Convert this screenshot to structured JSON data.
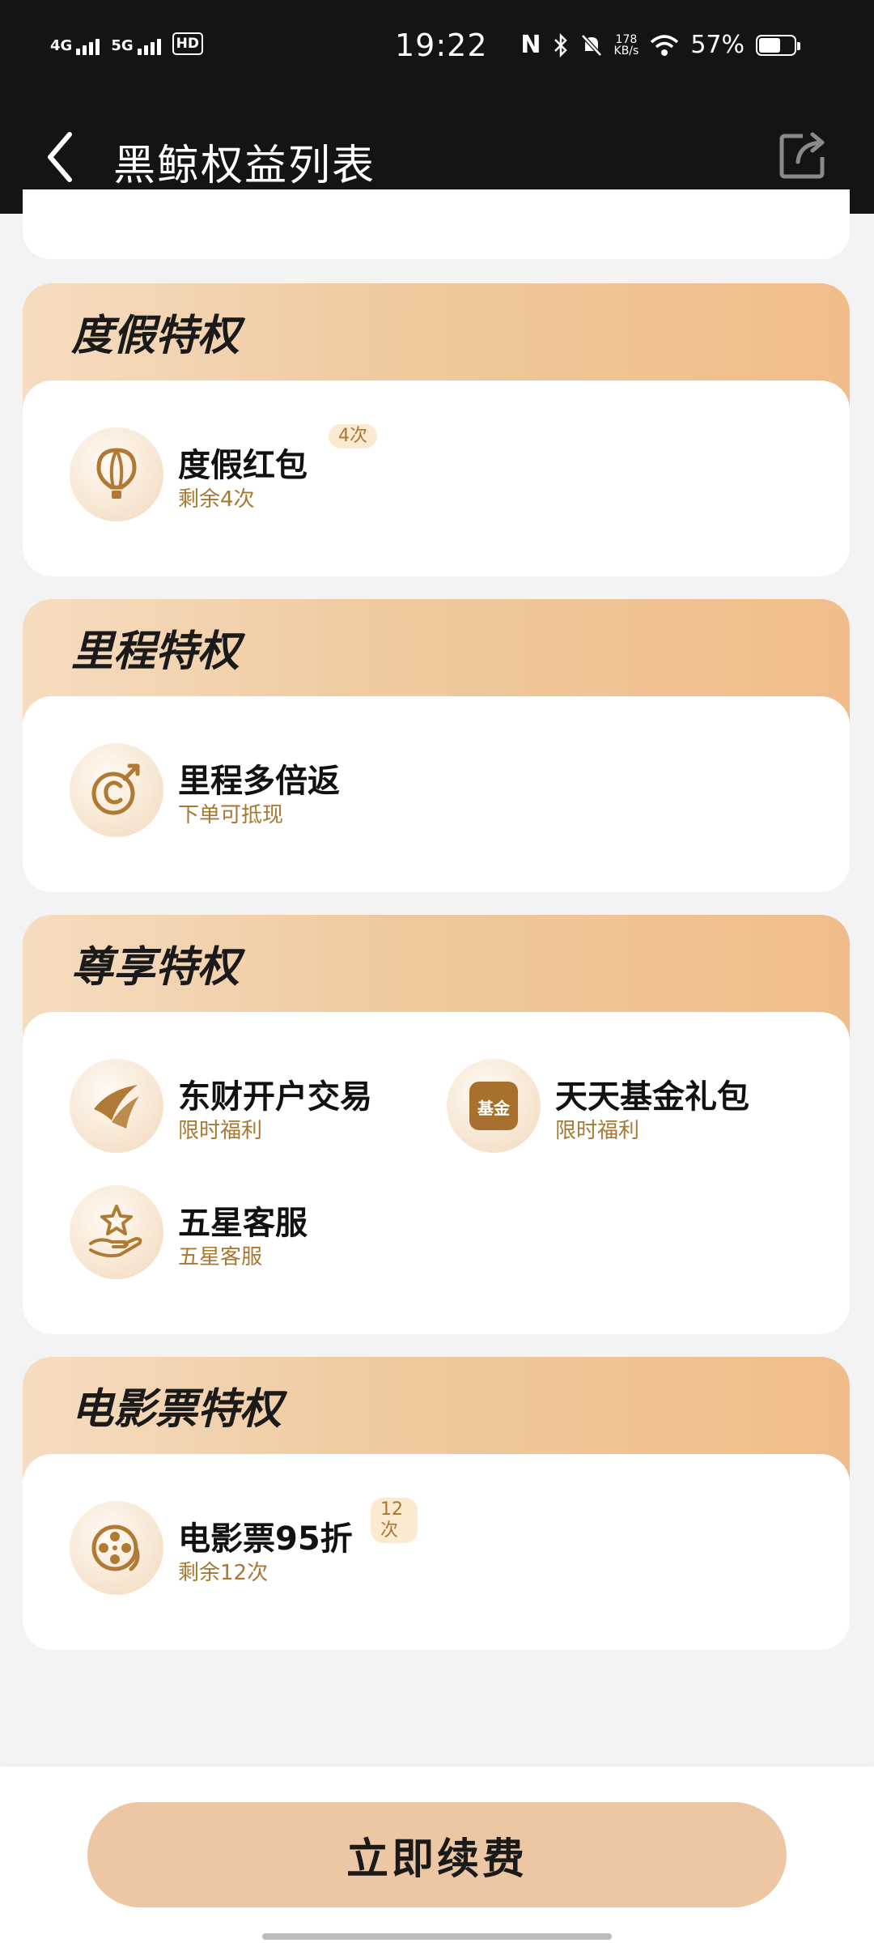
{
  "status_bar": {
    "signal1": "4G",
    "signal2": "5G",
    "hd": "HD",
    "time": "19:22",
    "speed_value": "178",
    "speed_unit": "KB/s",
    "battery": "57%"
  },
  "header": {
    "title": "黑鲸权益列表"
  },
  "sections": [
    {
      "title": "度假特权",
      "items": [
        {
          "name": "度假红包",
          "sub": "剩余4次",
          "badge": "4次",
          "icon": "hot-air-balloon-icon"
        }
      ]
    },
    {
      "title": "里程特权",
      "items": [
        {
          "name": "里程多倍返",
          "sub": "下单可抵现",
          "badge": "",
          "icon": "mileage-coin-icon"
        }
      ]
    },
    {
      "title": "尊享特权",
      "items": [
        {
          "name": "东财开户交易",
          "sub": "限时福利",
          "badge": "",
          "icon": "eastmoney-logo-icon"
        },
        {
          "name": "天天基金礼包",
          "sub": "限时福利",
          "badge": "",
          "icon": "fund-logo-icon",
          "icon_text": "基金"
        },
        {
          "name": "五星客服",
          "sub": "五星客服",
          "badge": "",
          "icon": "star-hand-icon"
        }
      ]
    },
    {
      "title": "电影票特权",
      "items": [
        {
          "name": "电影票95折",
          "sub": "剩余12次",
          "badge": "12次",
          "icon": "film-reel-icon"
        }
      ]
    }
  ],
  "bottom": {
    "renew_label": "立即续费"
  },
  "colors": {
    "header_bg": "#141414",
    "section_gradient_start": "#f6dcc0",
    "section_gradient_end": "#f0bd8a",
    "accent_text": "#a87833",
    "button_bg": "#edc6a4"
  }
}
